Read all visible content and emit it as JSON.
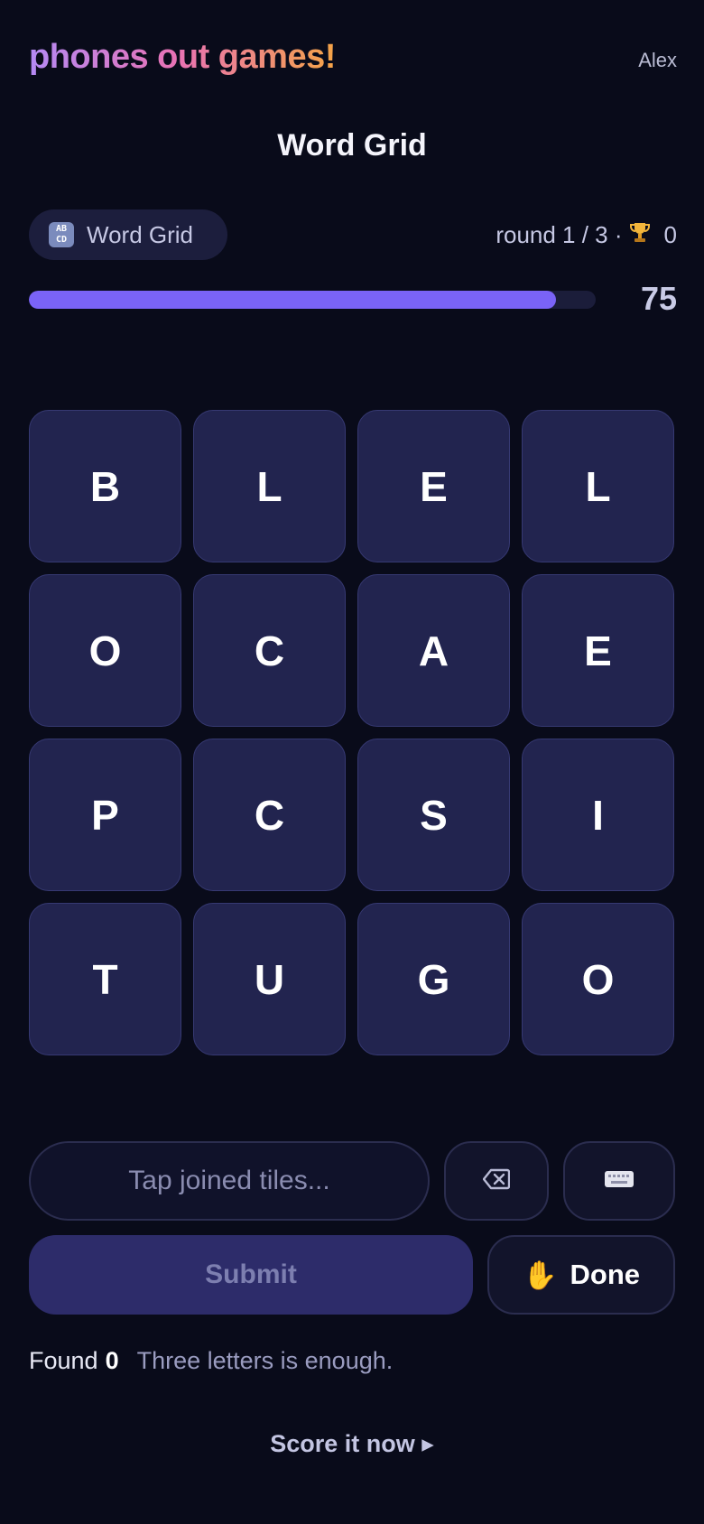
{
  "header": {
    "brand": "phones out games!",
    "user": "Alex"
  },
  "page_title": "Word Grid",
  "game_pill": {
    "icon_text_top": "AB",
    "icon_text_bottom": "CD",
    "label": "Word Grid"
  },
  "status": {
    "round_text": "round 1 / 3 ·",
    "trophy_icon": "trophy-icon",
    "score": "0"
  },
  "timer": {
    "value": "75",
    "progress_fraction": 0.93,
    "bar_color": "#7a63f7"
  },
  "grid": {
    "tiles": [
      "B",
      "L",
      "E",
      "L",
      "O",
      "C",
      "A",
      "E",
      "P",
      "C",
      "S",
      "I",
      "T",
      "U",
      "G",
      "O"
    ]
  },
  "input": {
    "placeholder": "Tap joined tiles..."
  },
  "buttons": {
    "submit": "Submit",
    "done": "Done",
    "done_icon": "✋"
  },
  "footer": {
    "found_label": "Found",
    "found_count": "0",
    "hint": "Three letters is enough.",
    "score_link": "Score it now ▸"
  },
  "colors": {
    "background": "#090b1a",
    "tile": "#22244f",
    "accent": "#7a63f7"
  }
}
